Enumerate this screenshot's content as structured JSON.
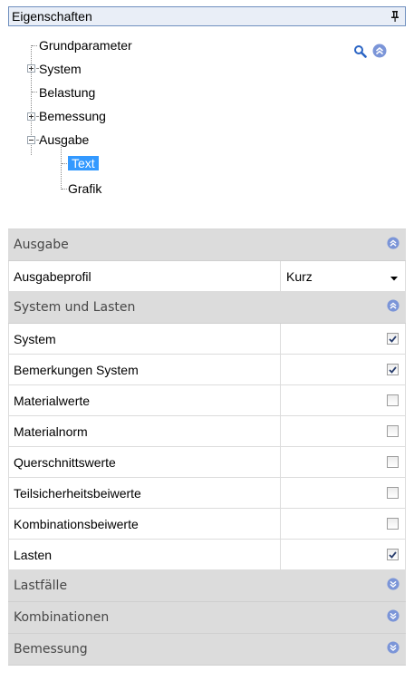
{
  "panel": {
    "title": "Eigenschaften"
  },
  "tree": {
    "items": [
      {
        "label": "Grundparameter"
      },
      {
        "label": "System",
        "expander": "+"
      },
      {
        "label": "Belastung"
      },
      {
        "label": "Bemessung",
        "expander": "+"
      },
      {
        "label": "Ausgabe",
        "expander": "-"
      },
      {
        "label": "Text",
        "selected": true
      },
      {
        "label": "Grafik"
      }
    ]
  },
  "toolbar": {
    "icons": [
      "search-icon",
      "collapse-all-icon"
    ]
  },
  "grid": {
    "categories": [
      {
        "label": "Ausgabe",
        "state": "expanded"
      },
      {
        "label": "System und Lasten",
        "state": "expanded"
      },
      {
        "label": "Lastfälle",
        "state": "collapsed"
      },
      {
        "label": "Kombinationen",
        "state": "collapsed"
      },
      {
        "label": "Bemessung",
        "state": "collapsed"
      }
    ],
    "ausgabe_rows": [
      {
        "name": "Ausgabeprofil",
        "value": "Kurz"
      }
    ],
    "system_rows": [
      {
        "name": "System",
        "checked": true
      },
      {
        "name": "Bemerkungen System",
        "checked": true
      },
      {
        "name": "Materialwerte",
        "checked": false
      },
      {
        "name": "Materialnorm",
        "checked": false
      },
      {
        "name": "Querschnittswerte",
        "checked": false
      },
      {
        "name": "Teilsicherheitsbeiwerte",
        "checked": false
      },
      {
        "name": "Kombinationsbeiwerte",
        "checked": false
      },
      {
        "name": "Lasten",
        "checked": true
      }
    ]
  },
  "colors": {
    "selection": "#3399ff",
    "category_bg": "#dcdcdc",
    "chevron": "#6e8fd6"
  }
}
